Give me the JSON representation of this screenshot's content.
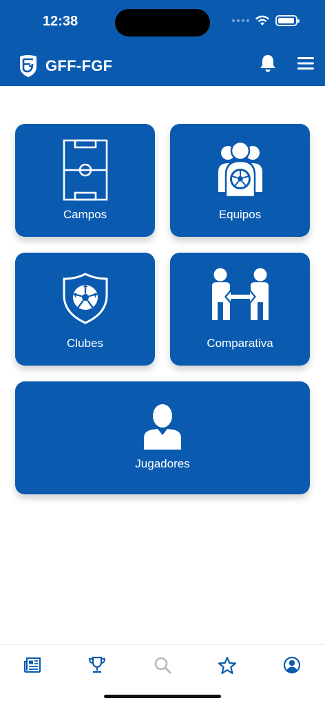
{
  "status_bar": {
    "time": "12:38",
    "battery_level": 0.95
  },
  "header": {
    "title": "GFF-FGF",
    "logo_icon": "gff-crest-icon",
    "notifications_icon": "bell-icon",
    "menu_icon": "hamburger-menu-icon"
  },
  "tiles": [
    {
      "label": "Campos",
      "icon": "football-pitch-icon"
    },
    {
      "label": "Equipos",
      "icon": "team-players-icon"
    },
    {
      "label": "Clubes",
      "icon": "shield-ball-icon"
    },
    {
      "label": "Comparativa",
      "icon": "compare-players-icon"
    },
    {
      "label": "Jugadores",
      "icon": "player-icon"
    }
  ],
  "bottom_nav": [
    {
      "icon": "news-icon",
      "active": false
    },
    {
      "icon": "trophy-icon",
      "active": false
    },
    {
      "icon": "search-icon",
      "active": false,
      "disabled": true
    },
    {
      "icon": "star-icon",
      "active": false
    },
    {
      "icon": "user-circle-icon",
      "active": false
    }
  ],
  "colors": {
    "primary": "#0a5bb0",
    "nav_icon": "#0a5bb0",
    "nav_icon_disabled": "#b8b8b8",
    "background": "#ffffff"
  }
}
